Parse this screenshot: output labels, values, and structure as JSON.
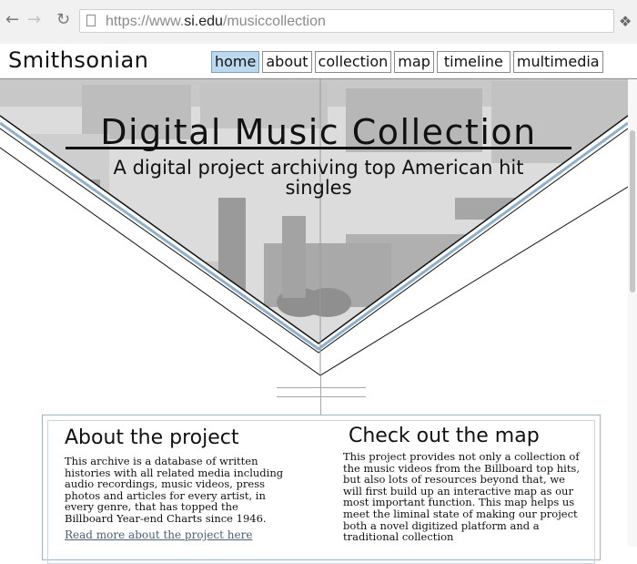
{
  "browser": {
    "url_prefix": "https://www.",
    "url_domain": "si.edu",
    "url_path": "/musiccollection"
  },
  "site": {
    "logo": "Smithsonian",
    "nav": [
      "home",
      "about",
      "collection",
      "map",
      "timeline",
      "multimedia"
    ],
    "active_nav": "home"
  },
  "hero": {
    "title": "Digital Music Collection",
    "subtitle": "A digital project archiving top American hit singles"
  },
  "about": {
    "title": "About the project",
    "text": "This archive is a database of written histories with all related media including audio recordings, music videos, press photos and articles for every artist, in every genre, that has topped the Billboard Year-end Charts since 1946.",
    "link": "Read more about the project here"
  },
  "map_section": {
    "title": "Check out the map",
    "text": "This project provides not only a collection of the music videos from the Billboard top hits, but also lots of resources beyond that, we will first build up an interactive map as our most important function. This map helps us meet the liminal state of making our project both a novel digitized platform and a traditional collection"
  },
  "colors": {
    "nav_active": "#bcd8ee",
    "hero_photo": "#cfcfcf",
    "chevron_accent": "#8fb0cc",
    "link": "#4b6072"
  }
}
